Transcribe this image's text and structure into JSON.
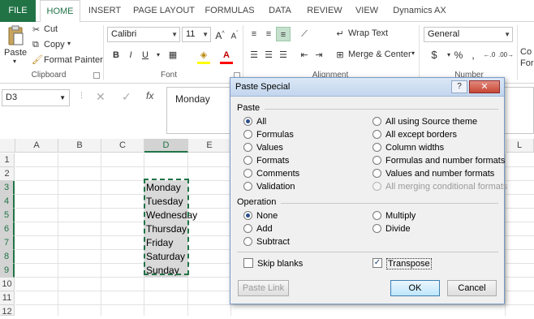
{
  "ribbon": {
    "tabs": [
      "FILE",
      "HOME",
      "INSERT",
      "PAGE LAYOUT",
      "FORMULAS",
      "DATA",
      "REVIEW",
      "VIEW",
      "Dynamics AX"
    ],
    "clipboard": {
      "paste": "Paste",
      "cut": "Cut",
      "copy": "Copy",
      "format_painter": "Format Painter",
      "group_label": "Clipboard"
    },
    "font": {
      "name": "Calibri",
      "size": "11",
      "group_label": "Font"
    },
    "alignment": {
      "wrap_text": "Wrap Text",
      "merge_center": "Merge & Center",
      "group_label": "Alignment"
    },
    "number": {
      "format": "General",
      "group_label": "Number"
    },
    "styles_partial": "Co Form"
  },
  "formula_bar": {
    "name_box": "D3",
    "content": "Monday"
  },
  "grid": {
    "columns": [
      "A",
      "B",
      "C",
      "D",
      "E"
    ],
    "right_column": "L",
    "rows": [
      "1",
      "2",
      "3",
      "4",
      "5",
      "6",
      "7",
      "8",
      "9",
      "10",
      "11",
      "12"
    ],
    "d_values": [
      "Monday",
      "Tuesday",
      "Wednesday",
      "Thursday",
      "Friday",
      "Saturday",
      "Sunday"
    ]
  },
  "dialog": {
    "title": "Paste Special",
    "help": "?",
    "close": "✕",
    "paste_label": "Paste",
    "paste_left": [
      "All",
      "Formulas",
      "Values",
      "Formats",
      "Comments",
      "Validation"
    ],
    "paste_right": [
      "All using Source theme",
      "All except borders",
      "Column widths",
      "Formulas and number formats",
      "Values and number formats",
      "All merging conditional formats"
    ],
    "operation_label": "Operation",
    "op_left": [
      "None",
      "Add",
      "Subtract"
    ],
    "op_right": [
      "Multiply",
      "Divide"
    ],
    "skip_blanks": "Skip blanks",
    "transpose": "Transpose",
    "paste_link": "Paste Link",
    "ok": "OK",
    "cancel": "Cancel"
  },
  "colors": {
    "excel_green": "#217346",
    "selection_gray": "#d9d9d9"
  }
}
